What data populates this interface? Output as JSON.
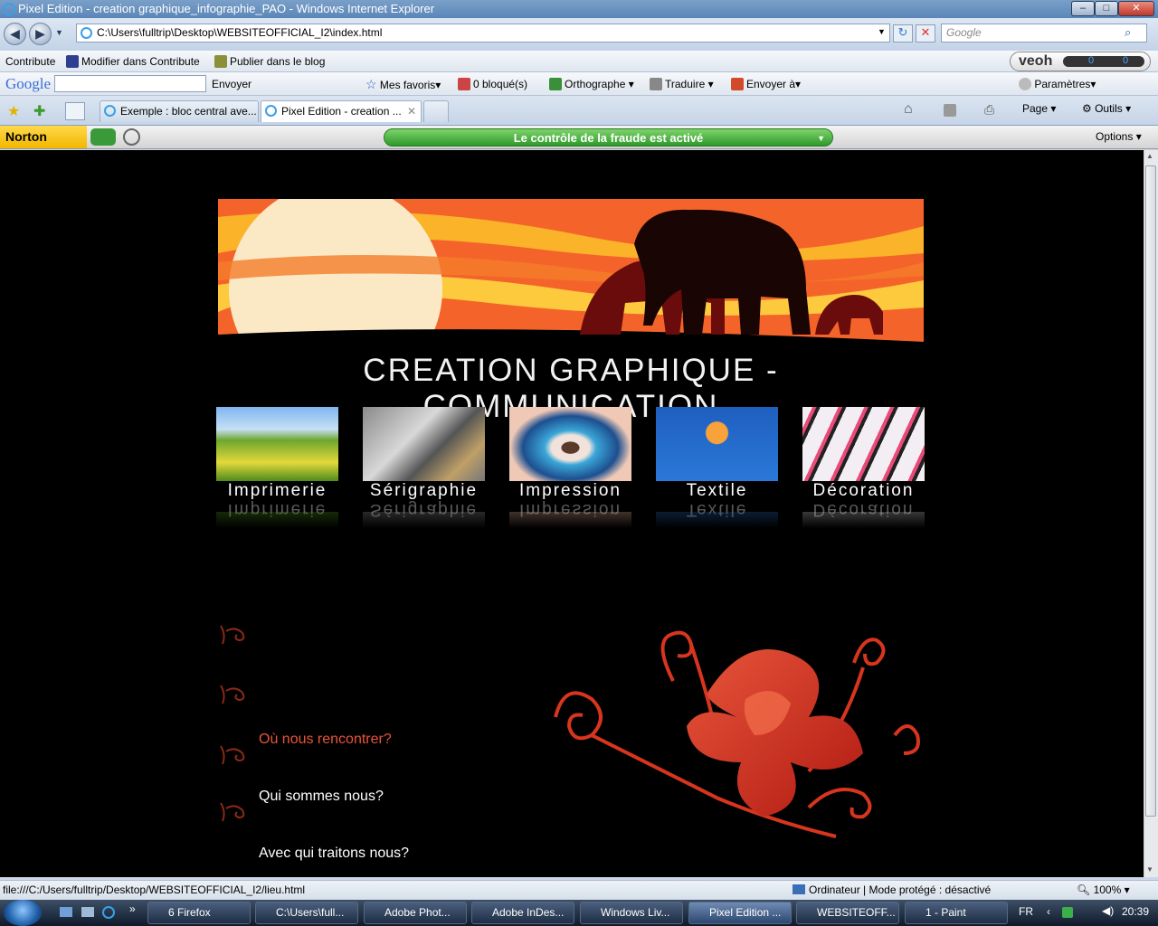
{
  "window": {
    "title": "Pixel Edition - creation graphique_infographie_PAO - Windows Internet Explorer"
  },
  "address": {
    "url": "C:\\Users\\fulltrip\\Desktop\\WEBSITEOFFICIAL_I2\\index.html",
    "search_placeholder": "Google"
  },
  "toolbar1": {
    "contribute": "Contribute",
    "modify": "Modifier dans Contribute",
    "publish": "Publier dans le blog",
    "veoh": "veoh",
    "counts": [
      "0",
      "0"
    ]
  },
  "toolbar2": {
    "google": "Google",
    "envoyer": "Envoyer",
    "favoris": "Mes favoris",
    "bloquees": "0 bloqué(s)",
    "ortho": "Orthographe",
    "traduire": "Traduire",
    "envoyer_a": "Envoyer à",
    "parametres": "Paramètres"
  },
  "tabs": [
    {
      "label": "Exemple : bloc central ave..."
    },
    {
      "label": "Pixel Edition - creation ..."
    }
  ],
  "cmdbar": {
    "page": "Page",
    "outils": "Outils"
  },
  "norton": {
    "brand": "Norton",
    "fraud": "Le contrôle de la fraude est activé",
    "options": "Options"
  },
  "page": {
    "tagline": "CREATION GRAPHIQUE - COMMUNICATION",
    "categories": [
      {
        "label": "Imprimerie"
      },
      {
        "label": "Sérigraphie"
      },
      {
        "label": "Impression"
      },
      {
        "label": "Textile"
      },
      {
        "label": "Décoration"
      }
    ],
    "links": [
      "Où nous rencontrer?",
      "Qui sommes nous?",
      "Avec qui traitons nous?"
    ]
  },
  "status": {
    "url": "file:///C:/Users/fulltrip/Desktop/WEBSITEOFFICIAL_I2/lieu.html",
    "zone": "Ordinateur | Mode protégé : désactivé",
    "zoom": "100%"
  },
  "taskbar": {
    "items": [
      "6 Firefox",
      "C:\\Users\\full...",
      "Adobe Phot...",
      "Adobe InDes...",
      "Windows Liv...",
      "Pixel Edition ...",
      "WEBSITEOFF...",
      "1 - Paint"
    ],
    "lang": "FR",
    "time": "20:39"
  },
  "colors": {
    "accent_link": "#e8553a",
    "banner_orange": "#f4642a",
    "banner_yellow": "#fbb42a"
  }
}
